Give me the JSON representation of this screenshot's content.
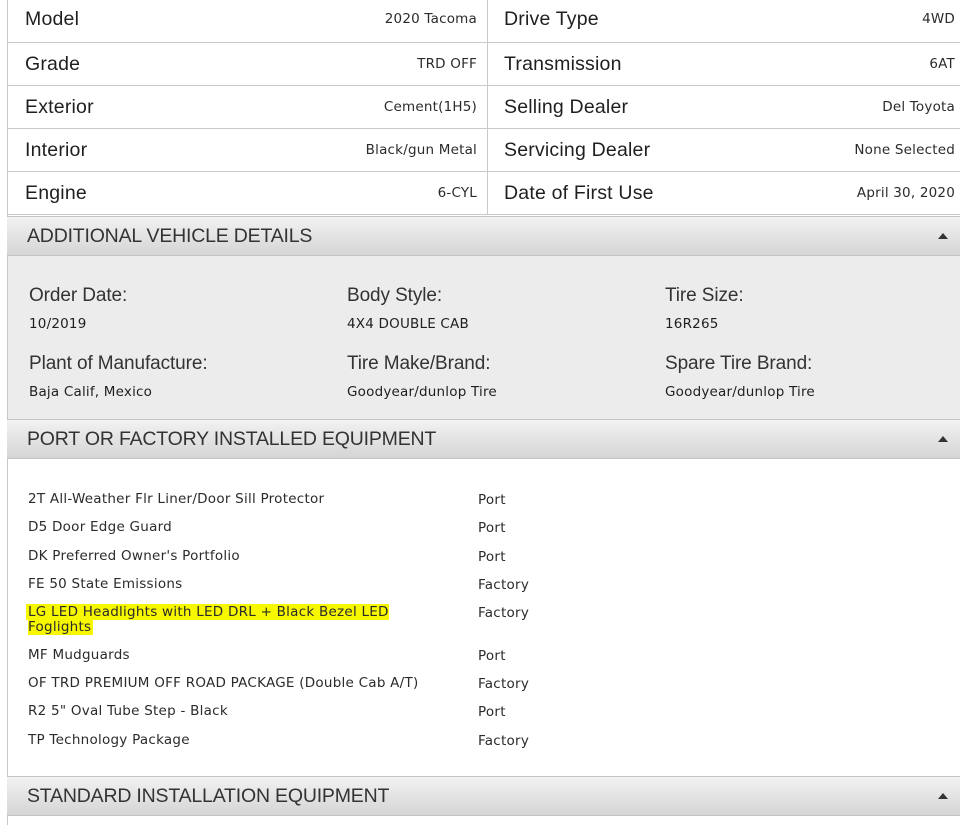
{
  "specs": [
    {
      "left_label": "Model",
      "left_value": "2020 Tacoma",
      "right_label": "Drive Type",
      "right_value": "4WD"
    },
    {
      "left_label": "Grade",
      "left_value": "TRD OFF",
      "right_label": "Transmission",
      "right_value": "6AT"
    },
    {
      "left_label": "Exterior",
      "left_value": "Cement(1H5)",
      "right_label": "Selling Dealer",
      "right_value": "Del Toyota"
    },
    {
      "left_label": "Interior",
      "left_value": "Black/gun Metal",
      "right_label": "Servicing Dealer",
      "right_value": "None Selected"
    },
    {
      "left_label": "Engine",
      "left_value": "6-CYL",
      "right_label": "Date of First Use",
      "right_value": "April 30, 2020"
    }
  ],
  "additional": {
    "title": "ADDITIONAL VEHICLE DETAILS",
    "items": [
      {
        "label": "Order Date:",
        "value": "10/2019"
      },
      {
        "label": "Body Style:",
        "value": "4X4 DOUBLE CAB"
      },
      {
        "label": "Tire Size:",
        "value": "16R265"
      },
      {
        "label": "Plant of Manufacture:",
        "value": "Baja Calif, Mexico"
      },
      {
        "label": "Tire Make/Brand:",
        "value": "Goodyear/dunlop Tire"
      },
      {
        "label": "Spare Tire Brand:",
        "value": "Goodyear/dunlop Tire"
      }
    ]
  },
  "equipment": {
    "title": "PORT OR FACTORY INSTALLED EQUIPMENT",
    "items": [
      {
        "name": "2T All-Weather Flr Liner/Door Sill Protector",
        "type": "Port"
      },
      {
        "name": "D5 Door Edge Guard",
        "type": "Port"
      },
      {
        "name": "DK Preferred Owner's Portfolio",
        "type": "Port"
      },
      {
        "name": "FE 50 State Emissions",
        "type": "Factory"
      },
      {
        "name": "LG LED Headlights with LED DRL + Black Bezel LED Foglights",
        "type": "Factory"
      },
      {
        "name": "MF Mudguards",
        "type": "Port"
      },
      {
        "name": "OF TRD PREMIUM OFF ROAD PACKAGE (Double Cab A/T)",
        "type": "Factory"
      },
      {
        "name": "R2 5\" Oval Tube Step - Black",
        "type": "Port"
      },
      {
        "name": "TP Technology Package",
        "type": "Factory"
      }
    ],
    "highlight_color": "#f7f700"
  },
  "standard": {
    "title": "STANDARD INSTALLATION EQUIPMENT"
  }
}
